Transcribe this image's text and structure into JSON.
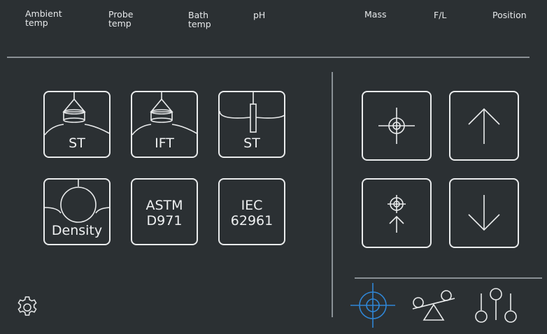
{
  "header": {
    "items": [
      {
        "label": "Ambient\ntemp"
      },
      {
        "label": "Probe\ntemp"
      },
      {
        "label": "Bath\ntemp"
      },
      {
        "label": "pH"
      },
      {
        "label": "Mass"
      },
      {
        "label": "F/L"
      },
      {
        "label": "Position"
      }
    ]
  },
  "methods": {
    "st_ring": "ST",
    "ift": "IFT",
    "st_plate": "ST",
    "density": "Density",
    "astm": "ASTM\nD971",
    "iec": "IEC\n62961"
  },
  "icons": {
    "settings": "gear-icon",
    "crosshair": "crosshair-icon",
    "up": "arrow-up-icon",
    "target_up": "crosshair-up-icon",
    "down": "arrow-down-icon",
    "nav_target": "target-icon",
    "nav_balance": "balance-icon",
    "nav_sliders": "sliders-icon"
  },
  "colors": {
    "background": "#2b3033",
    "foreground": "#e9ebec",
    "accent": "#2f86d6",
    "divider": "#8a9095"
  }
}
